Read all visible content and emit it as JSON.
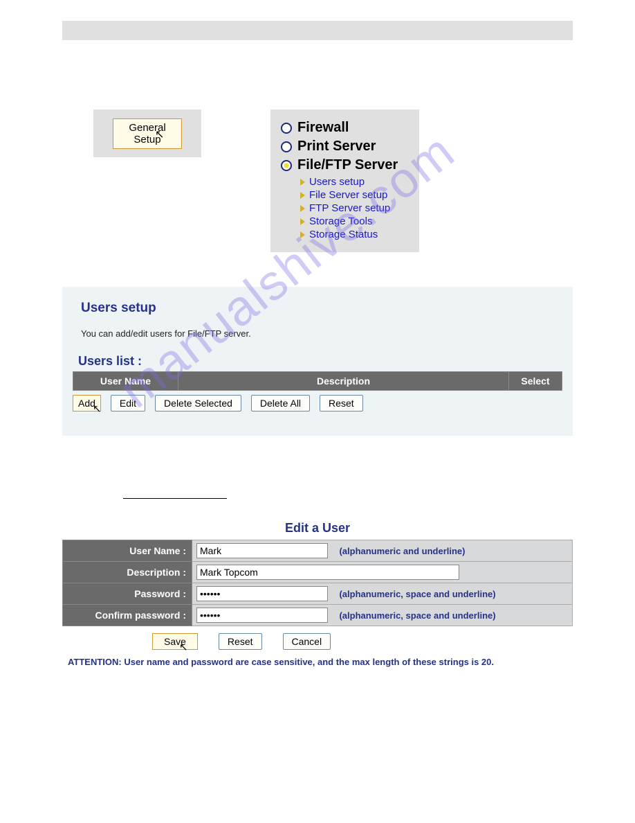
{
  "watermark": "manualshive.com",
  "general_setup": {
    "button_label": "General Setup"
  },
  "nav": {
    "items": [
      {
        "label": "Firewall",
        "selected": false
      },
      {
        "label": "Print Server",
        "selected": false
      },
      {
        "label": "File/FTP Server",
        "selected": true
      }
    ],
    "sublinks": [
      "Users setup",
      "File Server setup",
      "FTP Server setup",
      "Storage Tools",
      "Storage Status"
    ]
  },
  "users_setup": {
    "title": "Users setup",
    "description": "You can add/edit users for File/FTP server.",
    "list_label": "Users list  :",
    "columns": {
      "user_name": "User Name",
      "description": "Description",
      "select": "Select"
    },
    "buttons": {
      "add": "Add",
      "edit": "Edit",
      "delete_selected": "Delete Selected",
      "delete_all": "Delete All",
      "reset": "Reset"
    }
  },
  "edit_user": {
    "title": "Edit a User",
    "fields": {
      "user_name": {
        "label": "User Name  :",
        "value": "Mark",
        "hint": "(alphanumeric and underline)"
      },
      "description": {
        "label": "Description  :",
        "value": "Mark Topcom"
      },
      "password": {
        "label": "Password  :",
        "value": "••••••",
        "hint": "(alphanumeric, space and underline)"
      },
      "confirm": {
        "label": "Confirm password  :",
        "value": "••••••",
        "hint": "(alphanumeric, space and underline)"
      }
    },
    "buttons": {
      "save": "Save",
      "reset": "Reset",
      "cancel": "Cancel"
    },
    "attention": "ATTENTION: User name and password are case sensitive, and the max length of these strings is 20."
  }
}
